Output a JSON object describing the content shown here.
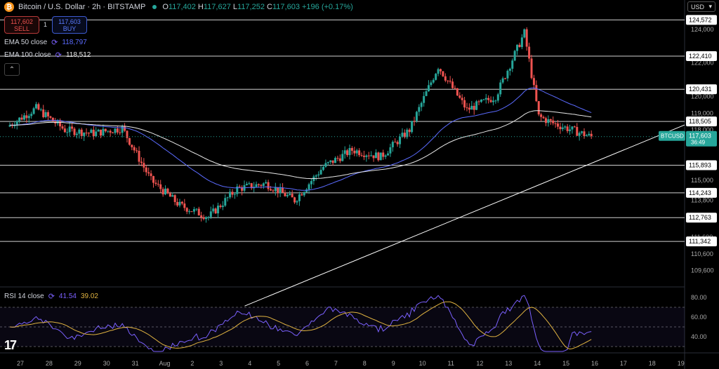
{
  "header": {
    "symbol": "Bitcoin / U.S. Dollar · 2h · BITSTAMP",
    "logo_glyph": "₿",
    "open_label": "O",
    "open": "117,402",
    "high_label": "H",
    "high": "117,627",
    "low_label": "L",
    "low": "117,252",
    "close_label": "C",
    "close": "117,603",
    "change": "+196 (+0.17%)"
  },
  "trade": {
    "sell_price": "117,602",
    "sell_label": "SELL",
    "qty": "1",
    "buy_price": "117,603",
    "buy_label": "BUY"
  },
  "indicators": {
    "ema50": {
      "label": "EMA 50 close",
      "value": "118,797",
      "color": "#5b6bff"
    },
    "ema100": {
      "label": "EMA 100 close",
      "value": "118,512",
      "color": "#e8e8e8"
    },
    "rsi": {
      "label": "RSI 14 close",
      "value1": "41.54",
      "value2": "39.02",
      "color1": "#7b61ff",
      "color2": "#e0b341"
    }
  },
  "currency": "USD",
  "colors": {
    "up": "#26a69a",
    "down": "#ef5350",
    "background": "#000000",
    "level_line": "#cfcfcf",
    "price_tag": "#26a69a"
  },
  "chart_data": {
    "type": "candlestick",
    "title": "Bitcoin / U.S. Dollar · 2h · BITSTAMP",
    "y_ticks": [
      "124,000",
      "122,000",
      "120,000",
      "119,000",
      "118,000",
      "115,000",
      "113,800",
      "111,600",
      "110,600",
      "109,600"
    ],
    "x_ticks": [
      "27",
      "28",
      "29",
      "30",
      "31",
      "Aug",
      "2",
      "3",
      "4",
      "5",
      "6",
      "7",
      "8",
      "9",
      "10",
      "11",
      "12",
      "13",
      "14",
      "15",
      "16",
      "17",
      "18",
      "19"
    ],
    "horizontal_levels": [
      124572,
      122410,
      120431,
      118505,
      115893,
      114243,
      112763,
      111342
    ],
    "level_labels": [
      "124,572",
      "122,410",
      "120,431",
      "118,505",
      "115,893",
      "114,243",
      "112,763",
      "111,342"
    ],
    "trendline": {
      "from": {
        "date": "Aug 1",
        "value": 110000
      },
      "to": {
        "date": "Aug 17",
        "value": 118300
      }
    },
    "current_price": {
      "symbol": "BTCUSD",
      "price": "117,603",
      "countdown": "36:49"
    },
    "price_path_keypoints": [
      {
        "date": "Jul 27",
        "price": 118200
      },
      {
        "date": "Jul 28",
        "price": 119300
      },
      {
        "date": "Jul 29",
        "price": 118000
      },
      {
        "date": "Jul 30",
        "price": 117800
      },
      {
        "date": "Jul 31",
        "price": 118100
      },
      {
        "date": "Aug 1",
        "price": 115000
      },
      {
        "date": "Aug 2",
        "price": 113500
      },
      {
        "date": "Aug 3",
        "price": 112800
      },
      {
        "date": "Aug 4",
        "price": 114500
      },
      {
        "date": "Aug 5",
        "price": 114800
      },
      {
        "date": "Aug 6",
        "price": 113800
      },
      {
        "date": "Aug 7",
        "price": 115800
      },
      {
        "date": "Aug 8",
        "price": 116800
      },
      {
        "date": "Aug 9",
        "price": 116400
      },
      {
        "date": "Aug 10",
        "price": 118000
      },
      {
        "date": "Aug 11",
        "price": 121800
      },
      {
        "date": "Aug 12",
        "price": 119200
      },
      {
        "date": "Aug 13",
        "price": 120000
      },
      {
        "date": "Aug 14",
        "price": 123800
      },
      {
        "date": "Aug 14",
        "price": 118800
      },
      {
        "date": "Aug 15",
        "price": 118400
      },
      {
        "date": "Aug 16",
        "price": 117603
      }
    ],
    "rsi_panel": {
      "y_ticks": [
        "80.00",
        "60.00",
        "40.00"
      ],
      "upper": 70,
      "middle": 50,
      "lower": 30
    }
  }
}
